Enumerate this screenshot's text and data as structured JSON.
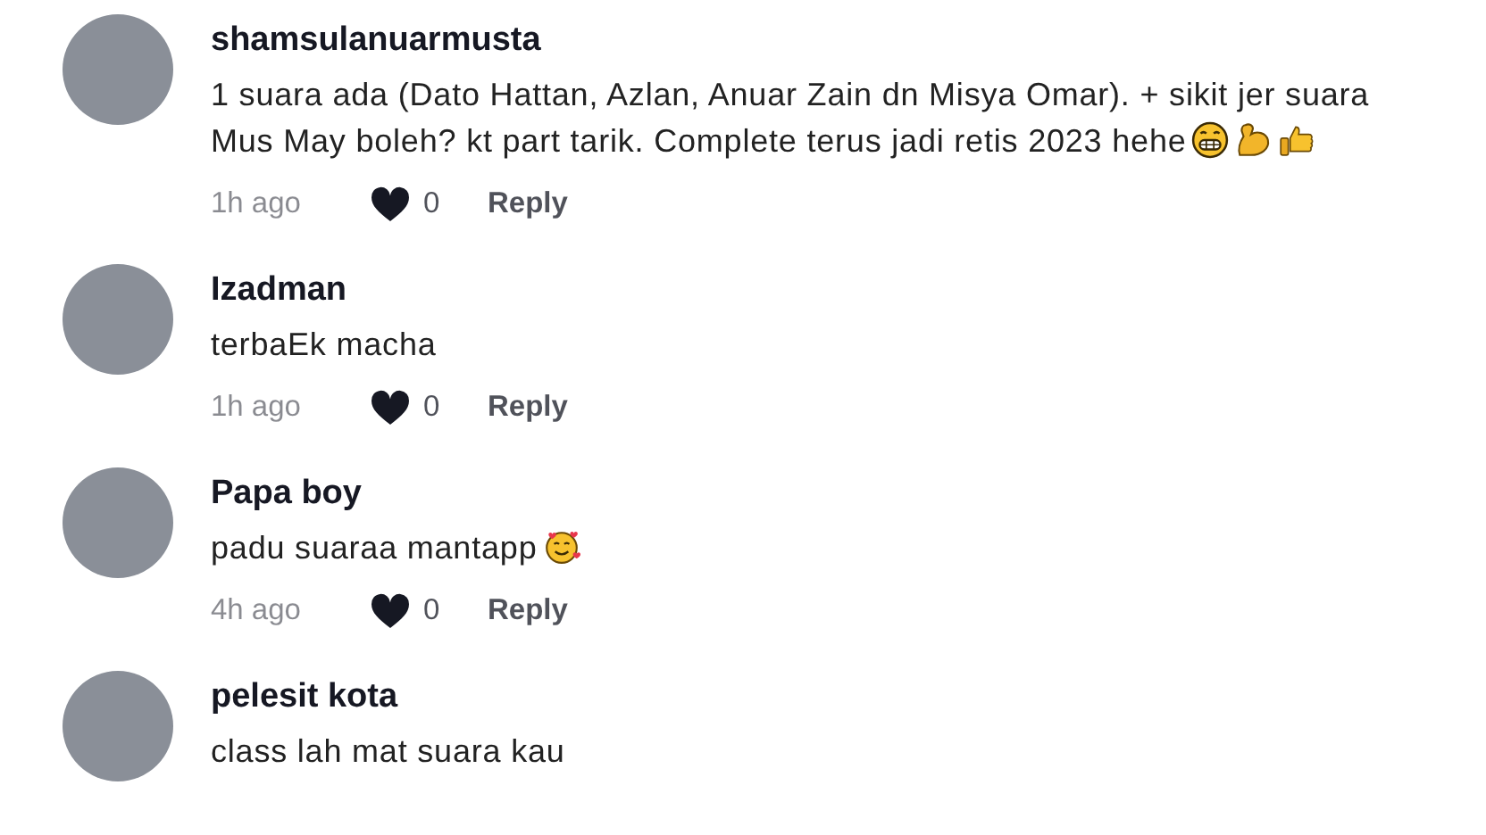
{
  "comments": [
    {
      "author": "shamsulanuarmusta",
      "text": "1 suara ada (Dato Hattan, Azlan, Anuar Zain dn Misya Omar). + sikit jer suara Mus May boleh? kt part tarik. Complete terus jadi retis 2023 hehe",
      "emojis": [
        {
          "kind": "grin"
        },
        {
          "kind": "muscle"
        },
        {
          "kind": "thumbs_up"
        }
      ],
      "time": "1h ago",
      "likes": "0",
      "reply": "Reply"
    },
    {
      "author": "Izadman",
      "text": "terbaEk macha",
      "time": "1h ago",
      "likes": "0",
      "reply": "Reply"
    },
    {
      "author": "Papa boy",
      "text": "padu suaraa mantapp",
      "emojis": [
        {
          "kind": "hearts_face"
        }
      ],
      "time": "4h ago",
      "likes": "0",
      "reply": "Reply"
    },
    {
      "author": "pelesit kota",
      "text": "class lah mat suara kau"
    }
  ]
}
